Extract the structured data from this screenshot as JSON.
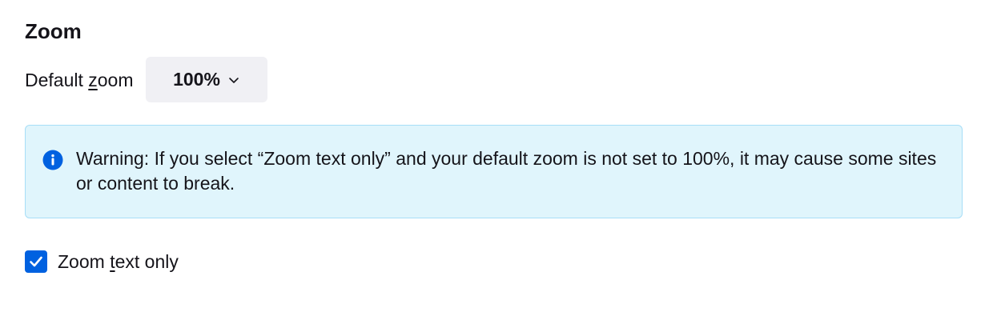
{
  "zoom": {
    "title": "Zoom",
    "default_zoom": {
      "label_before": "Default ",
      "label_accesskey": "z",
      "label_after": "oom",
      "value": "100%"
    },
    "warning": {
      "icon": "info-icon",
      "text": "Warning: If you select “Zoom text only” and your default zoom is not set to 100%, it may cause some sites or content to break."
    },
    "text_only": {
      "checked": true,
      "label_before": "Zoom ",
      "label_accesskey": "t",
      "label_after": "ext only"
    }
  },
  "colors": {
    "accent": "#0061e0",
    "warning_bg": "#e0f5fc",
    "warning_border": "#a7def7",
    "select_bg": "#f0f0f4"
  }
}
